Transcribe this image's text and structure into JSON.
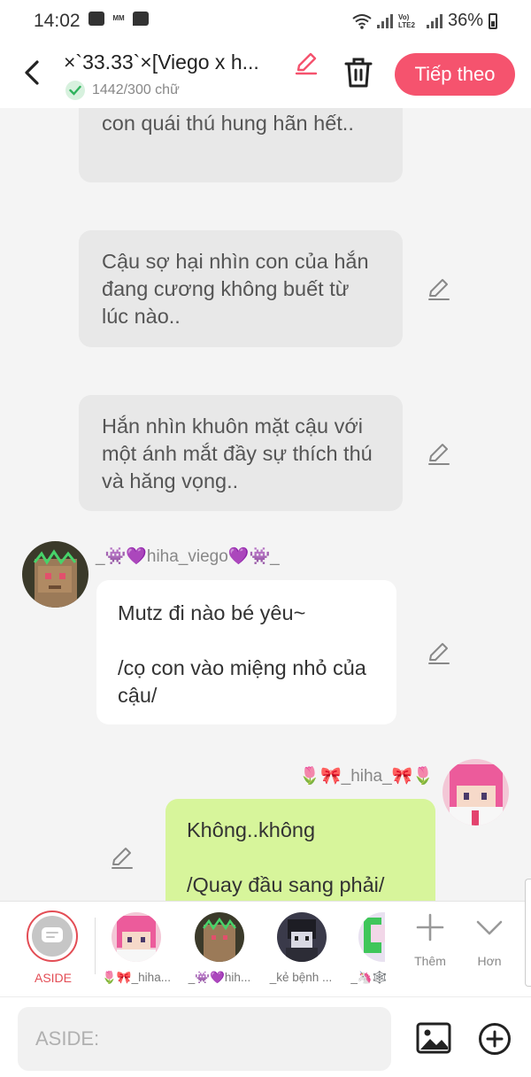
{
  "status_bar": {
    "time": "14:02",
    "mm_label": "MM",
    "volte_label": "Vo) LTE2",
    "battery": "36%"
  },
  "header": {
    "title": "×`33.33`×[Viego x h...",
    "word_count": "1442/300 chữ",
    "next_label": "Tiếp theo"
  },
  "messages": {
    "m1": "con quái thú hung hãn hết..",
    "m2": "Cậu sợ hại nhìn con của hắn đang cương không buết từ lúc nào..",
    "m3": "Hắn nhìn khuôn mặt cậu với một ánh mắt đầy sự thích thú và hăng vọng..",
    "m4_user": "_👾💜hiha_viego💜👾_",
    "m4": "Mutz đi nào bé yêu~\n\n/cọ con vào miệng nhỏ của cậu/",
    "m5_user": "🌷🎀_hiha_🎀🌷",
    "m5": "Không..không\n\n/Quay đầu sang phải/"
  },
  "character_bar": {
    "aside_label": "ASIDE",
    "characters": [
      {
        "label": "🌷🎀_hiha..."
      },
      {
        "label": "_👾💜hih..."
      },
      {
        "label": "_kẻ bệnh ..."
      },
      {
        "label": "_🦄🕸️"
      }
    ],
    "add_label": "Thêm",
    "more_label": "Hơn"
  },
  "input": {
    "placeholder": "ASIDE:"
  },
  "colors": {
    "accent": "#f5536e",
    "aside_red": "#e34d55",
    "green_bubble": "#d7f59b",
    "gray_bubble": "#e8e8e8"
  },
  "icons": [
    "back-arrow-icon",
    "pencil-icon",
    "check-icon",
    "trash-icon",
    "edit-pencil-icon",
    "aside-chat-icon",
    "plus-icon",
    "chevron-down-icon",
    "image-icon",
    "add-circle-icon"
  ]
}
